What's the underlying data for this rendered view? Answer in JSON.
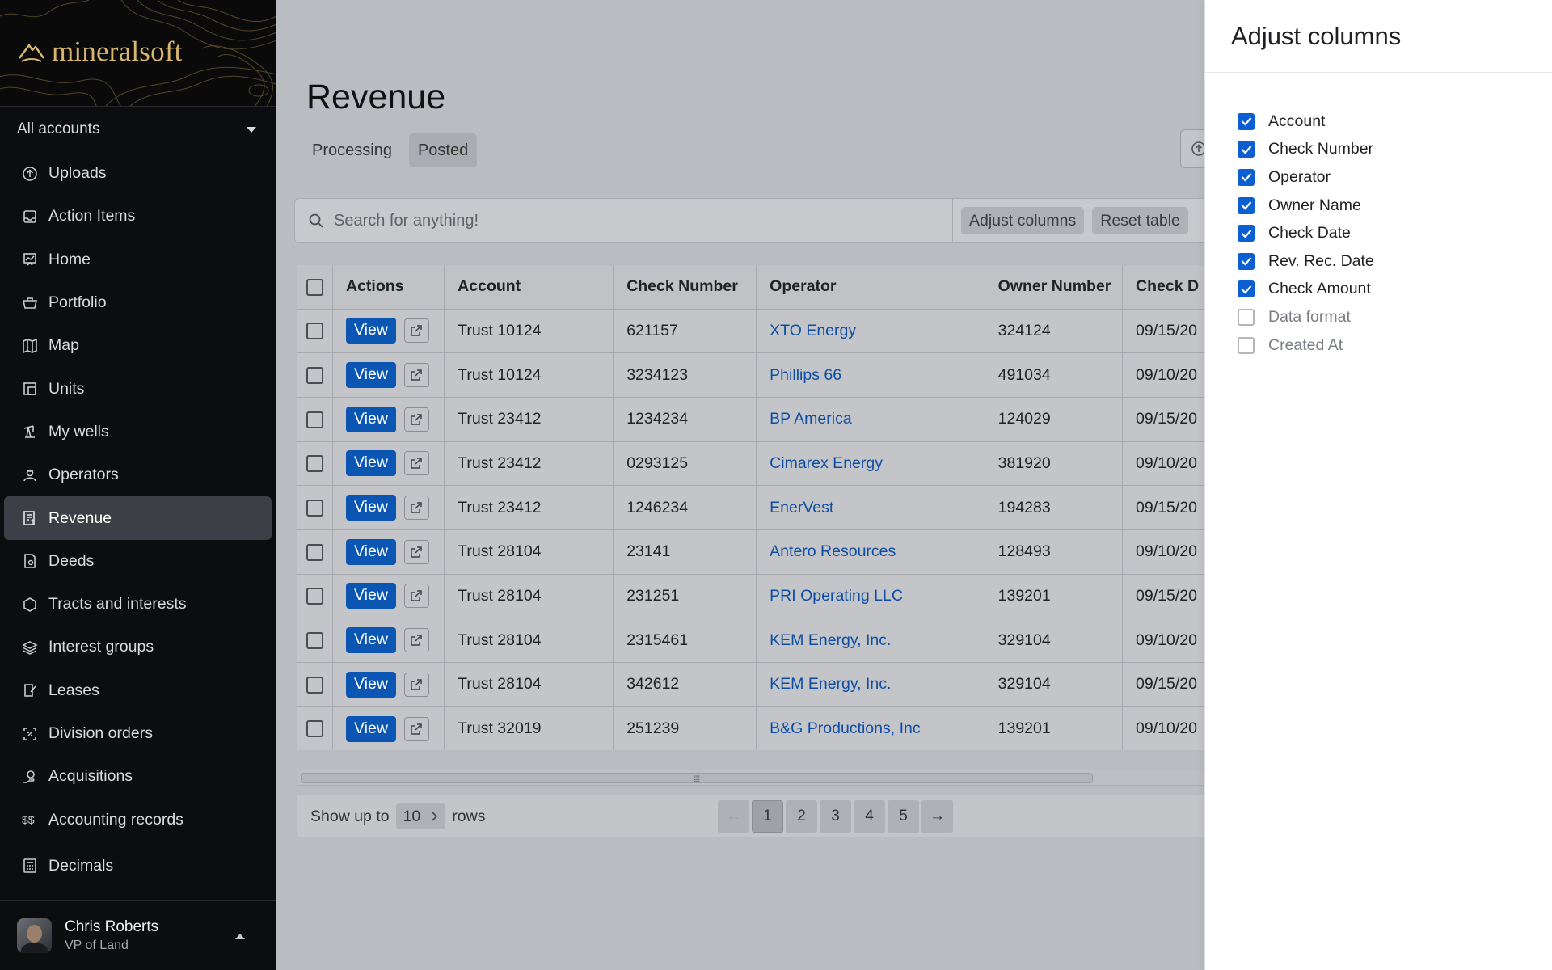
{
  "brand": {
    "name": "mineralsoft"
  },
  "sidebar": {
    "account_selector": "All accounts",
    "items": [
      {
        "label": "Uploads",
        "icon": "upload-icon"
      },
      {
        "label": "Action Items",
        "icon": "inbox-icon"
      },
      {
        "label": "Home",
        "icon": "dashboard-icon"
      },
      {
        "label": "Portfolio",
        "icon": "briefcase-icon"
      },
      {
        "label": "Map",
        "icon": "map-icon"
      },
      {
        "label": "Units",
        "icon": "units-icon"
      },
      {
        "label": "My wells",
        "icon": "pumpjack-icon"
      },
      {
        "label": "Operators",
        "icon": "operators-icon"
      },
      {
        "label": "Revenue",
        "icon": "revenue-icon",
        "active": true
      },
      {
        "label": "Deeds",
        "icon": "deed-icon"
      },
      {
        "label": "Tracts and interests",
        "icon": "hexagon-icon"
      },
      {
        "label": "Interest groups",
        "icon": "layers-icon"
      },
      {
        "label": "Leases",
        "icon": "lease-icon"
      },
      {
        "label": "Division orders",
        "icon": "division-icon"
      },
      {
        "label": "Acquisitions",
        "icon": "acquisition-icon"
      },
      {
        "label": "Accounting records",
        "icon": "dollar-icon"
      },
      {
        "label": "Decimals",
        "icon": "calculator-icon"
      }
    ],
    "user": {
      "name": "Chris Roberts",
      "role": "VP of Land"
    }
  },
  "main": {
    "title": "Revenue",
    "tabs": [
      {
        "label": "Processing",
        "active": false
      },
      {
        "label": "Posted",
        "active": true
      }
    ],
    "search": {
      "placeholder": "Search for anything!",
      "value": ""
    },
    "buttons": {
      "adjust": "Adjust columns",
      "reset": "Reset table"
    },
    "table": {
      "columns": [
        "Actions",
        "Account",
        "Check Number",
        "Operator",
        "Owner Number",
        "Check D"
      ],
      "view_label": "View",
      "rows": [
        {
          "account": "Trust 10124",
          "check": "621157",
          "operator": "XTO Energy",
          "owner": "324124",
          "date": "09/15/20"
        },
        {
          "account": "Trust 10124",
          "check": "3234123",
          "operator": "Phillips 66",
          "owner": "491034",
          "date": "09/10/20"
        },
        {
          "account": "Trust 23412",
          "check": "1234234",
          "operator": "BP America",
          "owner": "124029",
          "date": "09/15/20"
        },
        {
          "account": "Trust 23412",
          "check": "0293125",
          "operator": "Cimarex Energy",
          "owner": "381920",
          "date": "09/10/20"
        },
        {
          "account": "Trust 23412",
          "check": "1246234",
          "operator": "EnerVest",
          "owner": "194283",
          "date": "09/15/20"
        },
        {
          "account": "Trust 28104",
          "check": "23141",
          "operator": "Antero Resources",
          "owner": "128493",
          "date": "09/10/20"
        },
        {
          "account": "Trust 28104",
          "check": "231251",
          "operator": "PRI Operating LLC",
          "owner": "139201",
          "date": "09/15/20"
        },
        {
          "account": "Trust 28104",
          "check": "2315461",
          "operator": "KEM Energy, Inc.",
          "owner": "329104",
          "date": "09/10/20"
        },
        {
          "account": "Trust 28104",
          "check": "342612",
          "operator": "KEM Energy, Inc.",
          "owner": "329104",
          "date": "09/15/20"
        },
        {
          "account": "Trust 32019",
          "check": "251239",
          "operator": "B&G Productions, Inc",
          "owner": "139201",
          "date": "09/10/20"
        }
      ]
    },
    "footer": {
      "show_label": "Show up to",
      "rows_value": "10",
      "rows_label": "rows",
      "prev": "←",
      "next": "→",
      "pages": [
        "1",
        "2",
        "3",
        "4",
        "5"
      ],
      "current_page": "1"
    }
  },
  "drawer": {
    "title": "Adjust columns",
    "columns": [
      {
        "label": "Account",
        "checked": true
      },
      {
        "label": "Check Number",
        "checked": true
      },
      {
        "label": "Operator",
        "checked": true
      },
      {
        "label": "Owner Name",
        "checked": true
      },
      {
        "label": "Check Date",
        "checked": true
      },
      {
        "label": "Rev. Rec. Date",
        "checked": true
      },
      {
        "label": "Check Amount",
        "checked": true
      },
      {
        "label": "Data format",
        "checked": false
      },
      {
        "label": "Created At",
        "checked": false
      }
    ]
  }
}
